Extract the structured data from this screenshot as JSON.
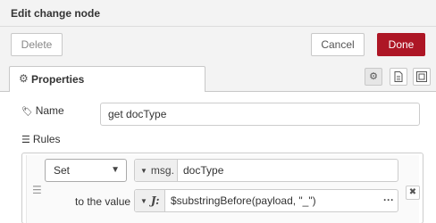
{
  "dialog": {
    "title": "Edit change node"
  },
  "buttons": {
    "delete": "Delete",
    "cancel": "Cancel",
    "done": "Done"
  },
  "tabs": [
    {
      "label": "Properties",
      "icon": "gear-icon",
      "active": true
    }
  ],
  "tab_icons": [
    "gear-icon",
    "document-icon",
    "appearance-icon"
  ],
  "fields": {
    "name": {
      "label": "Name",
      "icon": "tag-icon",
      "value": "get docType"
    }
  },
  "rules": {
    "label": "Rules",
    "icon": "list-icon",
    "items": [
      {
        "action": "Set",
        "property_type": "msg.",
        "property_value": "docType",
        "to_label": "to the value",
        "value_type": "J:",
        "value": "$substringBefore(payload, \"_\")"
      }
    ]
  },
  "colors": {
    "done_button": "#ad1625",
    "background": "#f3f3f3"
  }
}
